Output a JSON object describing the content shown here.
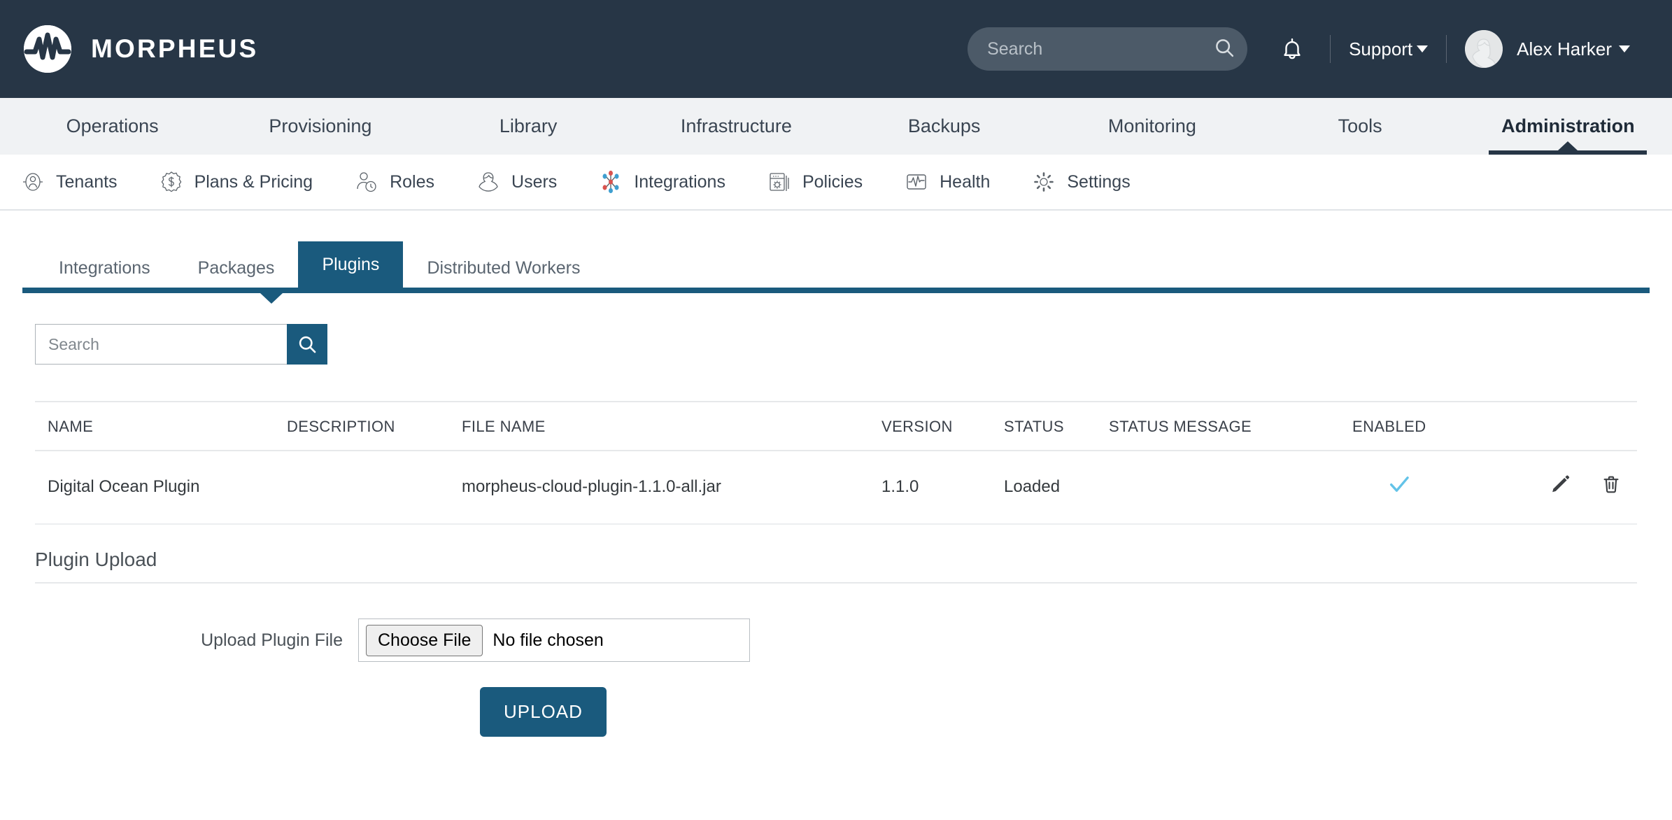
{
  "header": {
    "brand_name": "MORPHEUS",
    "logo_icon": "morpheus-waveform-logo",
    "search": {
      "placeholder": "Search",
      "value": "",
      "icon": "search-icon"
    },
    "notifications_icon": "bell-icon",
    "support_label": "Support",
    "user_name": "Alex Harker",
    "avatar_icon": "user-avatar-icon",
    "background_color": "#273646"
  },
  "primary_nav": {
    "items": [
      {
        "label": "Operations",
        "active": false
      },
      {
        "label": "Provisioning",
        "active": false
      },
      {
        "label": "Library",
        "active": false
      },
      {
        "label": "Infrastructure",
        "active": false
      },
      {
        "label": "Backups",
        "active": false
      },
      {
        "label": "Monitoring",
        "active": false
      },
      {
        "label": "Tools",
        "active": false
      },
      {
        "label": "Administration",
        "active": true
      }
    ],
    "active_indicator_color": "#273646"
  },
  "secondary_nav": {
    "items": [
      {
        "label": "Tenants",
        "icon": "tenant-person-circle-icon"
      },
      {
        "label": "Plans & Pricing",
        "icon": "dollar-badge-icon"
      },
      {
        "label": "Roles",
        "icon": "person-clock-icon"
      },
      {
        "label": "Users",
        "icon": "user-icon"
      },
      {
        "label": "Integrations",
        "icon": "integrations-molecule-icon",
        "active": true
      },
      {
        "label": "Policies",
        "icon": "window-gear-icon"
      },
      {
        "label": "Health",
        "icon": "heartbeat-icon"
      },
      {
        "label": "Settings",
        "icon": "gear-icon"
      }
    ]
  },
  "tabs": {
    "items": [
      {
        "label": "Integrations",
        "active": false
      },
      {
        "label": "Packages",
        "active": false
      },
      {
        "label": "Plugins",
        "active": true
      },
      {
        "label": "Distributed Workers",
        "active": false
      }
    ],
    "accent_color": "#1a5a7d"
  },
  "toolbar": {
    "search_placeholder": "Search",
    "search_value": "",
    "search_button_icon": "search-icon"
  },
  "table": {
    "columns": [
      "NAME",
      "DESCRIPTION",
      "FILE NAME",
      "VERSION",
      "STATUS",
      "STATUS MESSAGE",
      "ENABLED",
      ""
    ],
    "rows": [
      {
        "name": "Digital Ocean Plugin",
        "description": "",
        "file_name": "morpheus-cloud-plugin-1.1.0-all.jar",
        "version": "1.1.0",
        "status": "Loaded",
        "status_message": "",
        "enabled": true,
        "enabled_icon": "check-icon",
        "enabled_color": "#63c3e8",
        "edit_icon": "pencil-icon",
        "delete_icon": "trash-icon"
      }
    ]
  },
  "upload_section": {
    "title": "Plugin Upload",
    "file_label": "Upload Plugin File",
    "choose_file_label": "Choose File",
    "file_status": "No file chosen",
    "upload_button_label": "UPLOAD",
    "upload_button_color": "#1a5a7d"
  }
}
